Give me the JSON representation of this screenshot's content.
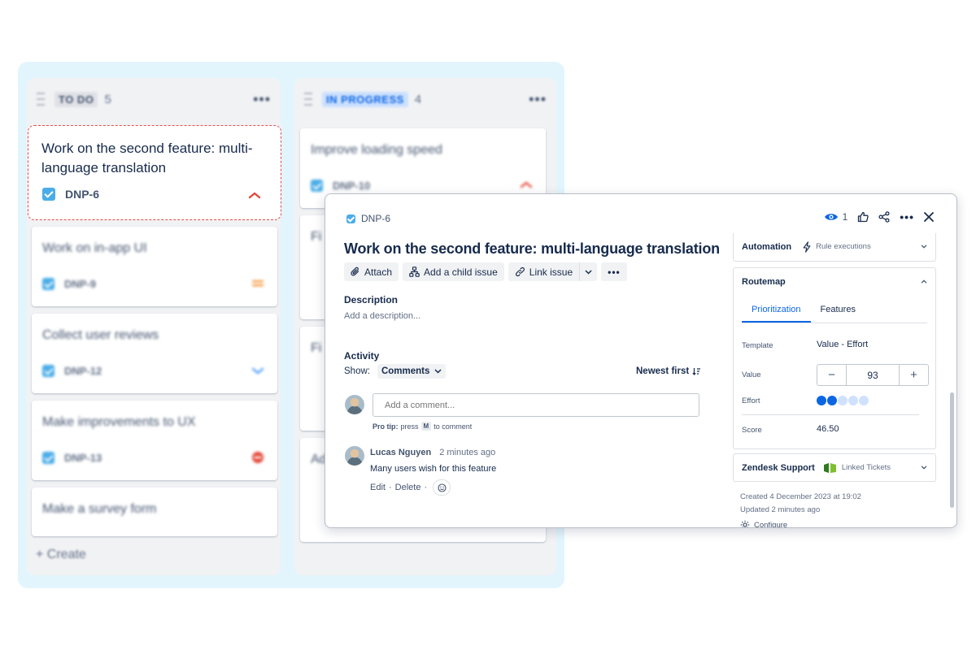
{
  "board": {
    "columns": [
      {
        "name": "TO DO",
        "count": "5"
      },
      {
        "name": "IN PROGRESS",
        "count": "4"
      }
    ],
    "todo_cards": [
      {
        "title": "Work on the second feature: multi-language translation",
        "key": "DNP-6",
        "priority": "high"
      },
      {
        "title": "Work on in-app UI",
        "key": "DNP-9",
        "priority": "medium"
      },
      {
        "title": "Collect user reviews",
        "key": "DNP-12",
        "priority": "low"
      },
      {
        "title": "Make improvements to UX",
        "key": "DNP-13",
        "priority": "blocker"
      },
      {
        "title": "Make a survey form",
        "key": "",
        "priority": ""
      }
    ],
    "progress_cards": [
      {
        "title": "Improve loading speed",
        "key": "DNP-10",
        "priority": "high"
      },
      {
        "title": "Fi",
        "key": "",
        "priority": ""
      },
      {
        "title": "Fi",
        "key": "",
        "priority": ""
      },
      {
        "title": "Ad",
        "key": "",
        "priority": ""
      }
    ],
    "create_label": "+ Create",
    "more_glyph": "•••"
  },
  "issue": {
    "key": "DNP-6",
    "watchers": "1",
    "title": "Work on the second feature: multi-language translation",
    "toolbar": {
      "attach": "Attach",
      "child": "Add a child issue",
      "link": "Link issue",
      "more": "•••"
    },
    "description": {
      "label": "Description",
      "placeholder": "Add a description..."
    },
    "activity": {
      "label": "Activity",
      "show_label": "Show:",
      "show_value": "Comments",
      "sort_label": "Newest first",
      "comment_placeholder": "Add a comment...",
      "pro_tip_prefix": "Pro tip:",
      "pro_tip_press": "press",
      "pro_tip_key": "M",
      "pro_tip_suffix": "to comment",
      "comments": [
        {
          "author": "Lucas Nguyen",
          "time": "2 minutes ago",
          "body": "Many users wish for this feature",
          "edit": "Edit",
          "delete": "Delete"
        }
      ]
    },
    "panel": {
      "automation": {
        "label": "Automation",
        "sub": "Rule executions"
      },
      "routemap": {
        "label": "Routemap",
        "tabs": [
          "Prioritization",
          "Features"
        ],
        "template_label": "Template",
        "template_value": "Value - Effort",
        "value_label": "Value",
        "value": "93",
        "effort_label": "Effort",
        "effort": 2,
        "effort_max": 5,
        "score_label": "Score",
        "score": "46.50"
      },
      "zendesk": {
        "label": "Zendesk Support",
        "sub": "Linked Tickets"
      },
      "created": "Created 4 December 2023 at 19:02",
      "updated": "Updated 2 minutes ago",
      "configure": "Configure"
    }
  },
  "colors": {
    "accent": "#0c66e4",
    "focus_border": "#e34a4a",
    "board_bg": "#e3f5fc",
    "story_icon": "#4bade8"
  }
}
